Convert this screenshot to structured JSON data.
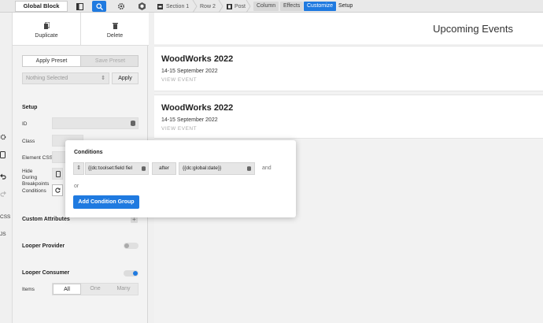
{
  "topbar": {
    "global_block": "Global Block",
    "breadcrumbs": [
      {
        "label": "Section 1",
        "icon": "section-icon"
      },
      {
        "label": "Row 2"
      },
      {
        "label": "Post",
        "icon": "post-icon"
      }
    ],
    "buttons": [
      {
        "label": "Column",
        "state": "normal"
      },
      {
        "label": "Effects",
        "state": "normal"
      },
      {
        "label": "Customize",
        "state": "active"
      },
      {
        "label": "Setup",
        "state": "plain"
      }
    ],
    "accent": "#1f7ae0"
  },
  "rail": {
    "items": [
      "CSS",
      "JS"
    ]
  },
  "panel": {
    "duplicate_label": "Duplicate",
    "delete_label": "Delete",
    "preset_tabs": [
      "Apply Preset",
      "Save Preset"
    ],
    "preset_select_placeholder": "Nothing Selected",
    "apply_label": "Apply",
    "setup_title": "Setup",
    "fields": {
      "id": "ID",
      "class": "Class",
      "element_css": "Element CSS",
      "hide_during_breakpoints": "Hide During Breakpoints",
      "conditions": "Conditions"
    },
    "custom_attributes": "Custom Attributes",
    "looper_provider": "Looper Provider",
    "looper_consumer": "Looper Consumer",
    "items_label": "Items",
    "items_options": [
      "All",
      "One",
      "Many"
    ],
    "items_selected": "All"
  },
  "canvas": {
    "heading": "Upcoming Events",
    "events": [
      {
        "title": "WoodWorks 2022",
        "date": "14-15 September 2022",
        "link": "VIEW EVENT"
      },
      {
        "title": "WoodWorks 2022",
        "date": "14-15 September 2022",
        "link": "VIEW EVENT"
      }
    ]
  },
  "conditions_popup": {
    "title": "Conditions",
    "field": "{{dc:toolset:field fiel",
    "operator": "after",
    "value": "{{dc:global:date}}",
    "and_label": "and",
    "or_label": "or",
    "add_group_label": "Add Condition Group"
  }
}
